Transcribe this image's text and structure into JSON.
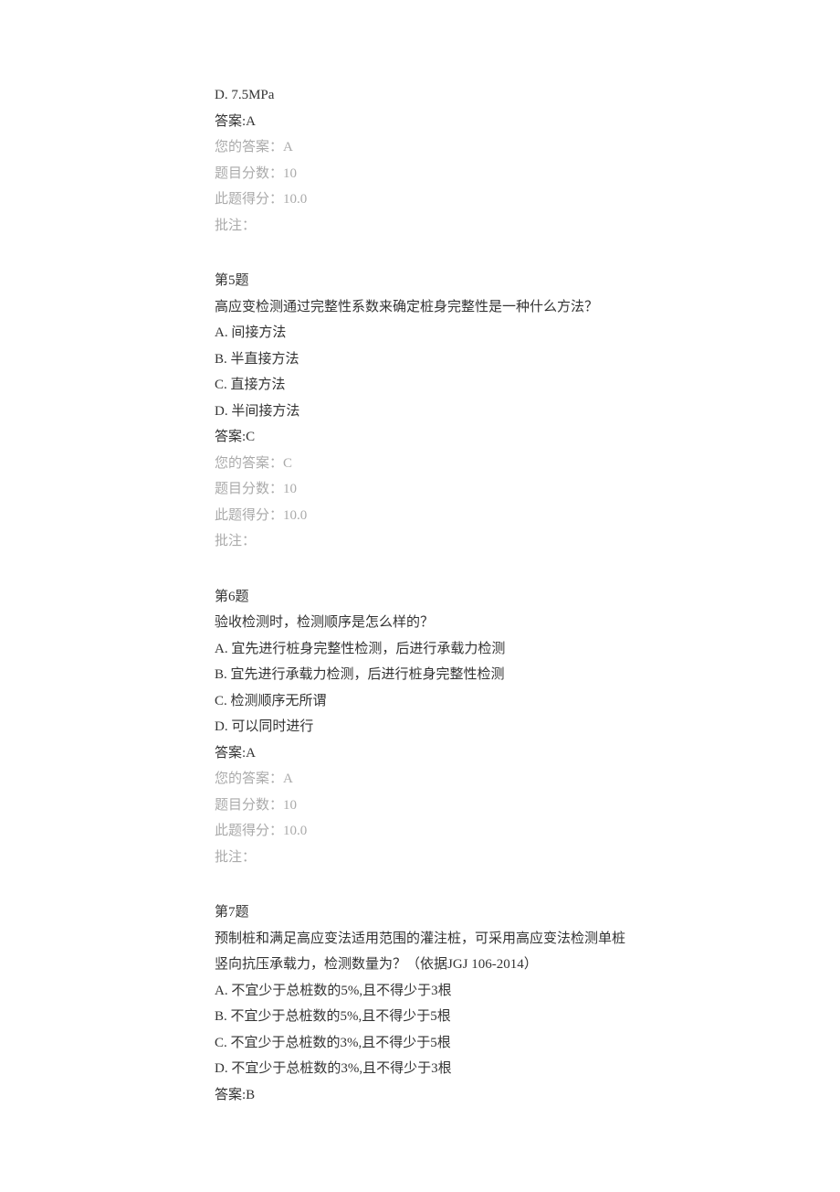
{
  "q4_partial": {
    "option_d": "D. 7.5MPa",
    "answer_line": "答案:A",
    "your_answer": "您的答案：A",
    "score_total": "题目分数：10",
    "score_got": "此题得分：10.0",
    "remark": "批注："
  },
  "q5": {
    "header": "第5题",
    "stem": "高应变检测通过完整性系数来确定桩身完整性是一种什么方法？",
    "options": [
      "A. 间接方法",
      "B. 半直接方法",
      "C. 直接方法",
      "D. 半间接方法"
    ],
    "answer_line": "答案:C",
    "your_answer": "您的答案：C",
    "score_total": "题目分数：10",
    "score_got": "此题得分：10.0",
    "remark": "批注："
  },
  "q6": {
    "header": "第6题",
    "stem": "验收检测时，检测顺序是怎么样的？",
    "options": [
      "A. 宜先进行桩身完整性检测，后进行承载力检测",
      "B. 宜先进行承载力检测，后进行桩身完整性检测",
      "C. 检测顺序无所谓",
      "D. 可以同时进行"
    ],
    "answer_line": "答案:A",
    "your_answer": "您的答案：A",
    "score_total": "题目分数：10",
    "score_got": "此题得分：10.0",
    "remark": "批注："
  },
  "q7": {
    "header": "第7题",
    "stem": "预制桩和满足高应变法适用范围的灌注桩，可采用高应变法检测单桩竖向抗压承载力，检测数量为？（依据JGJ 106-2014）",
    "options": [
      "A. 不宜少于总桩数的5%,且不得少于3根",
      "B. 不宜少于总桩数的5%,且不得少于5根",
      "C. 不宜少于总桩数的3%,且不得少于5根",
      "D. 不宜少于总桩数的3%,且不得少于3根"
    ],
    "answer_line": "答案:B"
  }
}
